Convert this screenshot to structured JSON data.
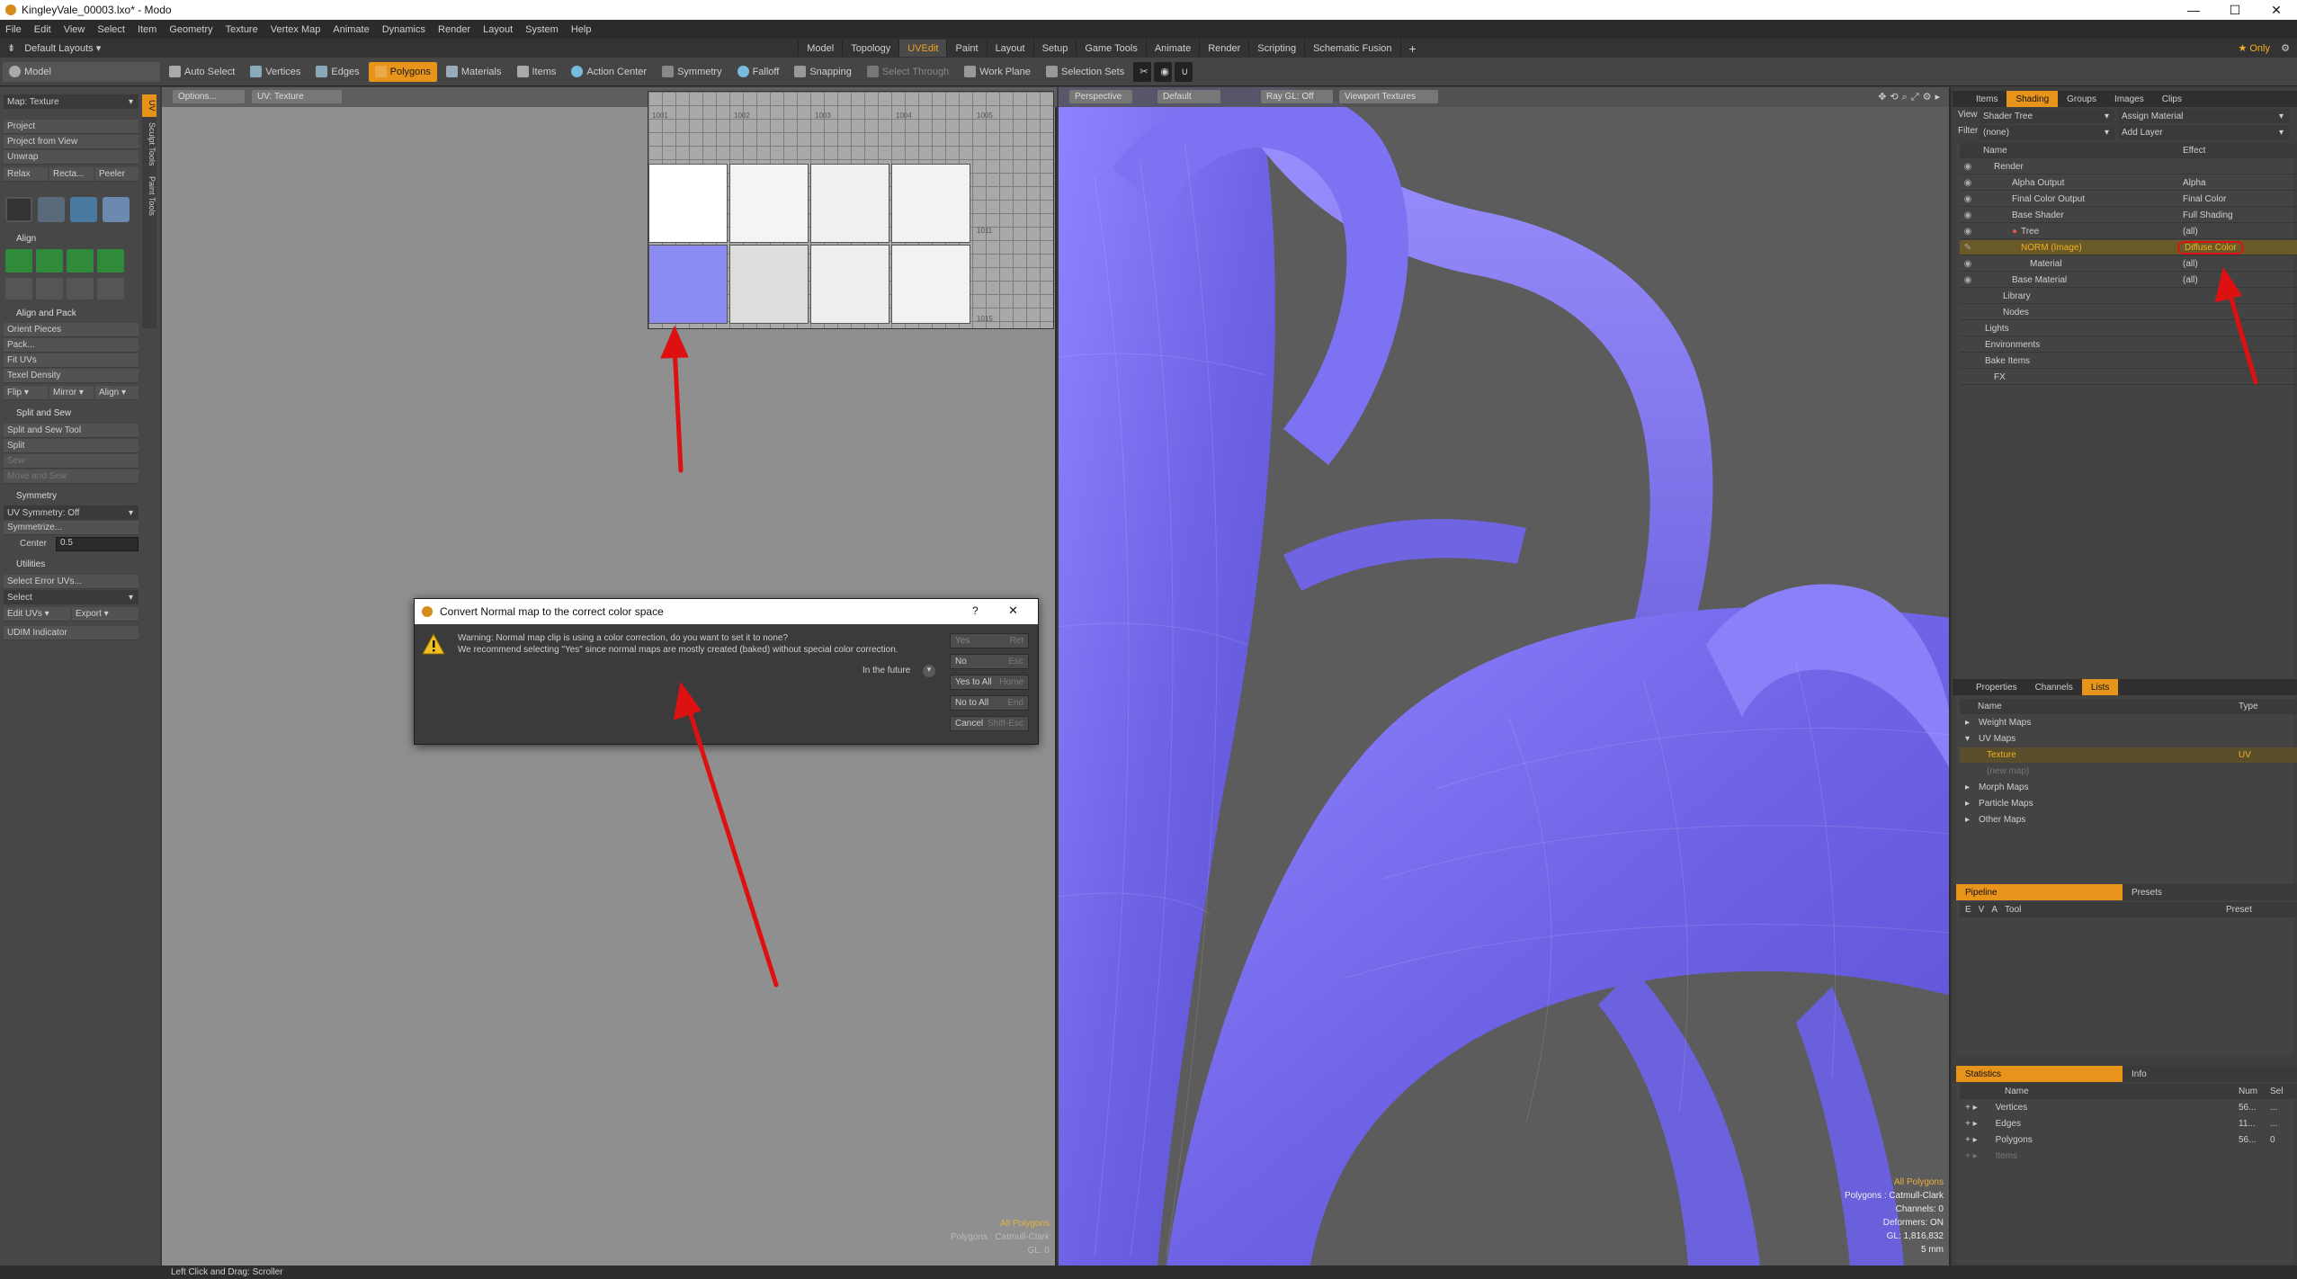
{
  "window": {
    "title": "KingleyVale_00003.lxo* - Modo",
    "controls": [
      "—",
      "☐",
      "✕"
    ]
  },
  "menu": [
    "File",
    "Edit",
    "View",
    "Select",
    "Item",
    "Geometry",
    "Texture",
    "Vertex Map",
    "Animate",
    "Dynamics",
    "Render",
    "Layout",
    "System",
    "Help"
  ],
  "layouts": {
    "default_label": "Default Layouts ▾",
    "tabs": [
      "Model",
      "Topology",
      "UVEdit",
      "Paint",
      "Layout",
      "Setup",
      "Game Tools",
      "Animate",
      "Render",
      "Scripting",
      "Schematic Fusion"
    ],
    "active": "UVEdit",
    "add": "+",
    "only": "★ Only"
  },
  "toolbar": {
    "mode": "Model",
    "items": [
      "Auto Select",
      "Vertices",
      "Edges",
      "Polygons",
      "Materials",
      "Items",
      "Action Center",
      "Symmetry",
      "Falloff",
      "Snapping",
      "Select Through",
      "Work Plane",
      "Selection Sets"
    ],
    "selected": "Polygons"
  },
  "left_panel": {
    "map": "Map: Texture",
    "project": [
      "Project",
      "Project from View",
      "Unwrap"
    ],
    "relax_row": [
      "Relax",
      "Recta...",
      "Peeler"
    ],
    "align_head": "Align",
    "align_pack_head": "Align and Pack",
    "align_pack": [
      "Orient Pieces",
      "Pack...",
      "Fit UVs",
      "Texel Density"
    ],
    "flip_row": [
      "Flip ▾",
      "Mirror ▾",
      "Align ▾"
    ],
    "split_head": "Split and Sew",
    "split": [
      "Split and Sew Tool",
      "Split",
      "Sew",
      "Move and Sew"
    ],
    "sym_head": "Symmetry",
    "uv_symmetry": "UV Symmetry: Off",
    "symmetrize": "Symmetrize...",
    "center_label": "Center",
    "center_value": "0.5",
    "util_head": "Utilities",
    "select_error": "Select Error UVs...",
    "select": "Select",
    "edit_uvs": "Edit UVs ▾",
    "export": "Export ▾",
    "udim": "UDIM Indicator",
    "side_tabs": [
      "UV",
      "Sculpt Tools",
      "Paint Tools"
    ]
  },
  "uv_view": {
    "options": "Options...",
    "uv_label": "UV: Texture",
    "udims": [
      "1001",
      "1002",
      "1003",
      "1004",
      "1005",
      "1011",
      "1015"
    ],
    "overlay": [
      "All Polygons",
      "Polygons : Catmull-Clark",
      "GL: 0"
    ]
  },
  "view3d": {
    "buttons": [
      "Perspective",
      "Default",
      "Ray GL: Off",
      "Viewport Textures"
    ],
    "overlay": [
      "All Polygons",
      "Polygons : Catmull-Clark",
      "Channels: 0",
      "Deformers: ON",
      "GL: 1,816,832",
      "5 mm"
    ]
  },
  "shading": {
    "tabs": [
      "Items",
      "Shading",
      "Groups",
      "Images",
      "Clips"
    ],
    "active": "Shading",
    "view_label": "View",
    "view_value": "Shader Tree",
    "assign": "Assign Material",
    "filter_label": "Filter",
    "filter_value": "(none)",
    "add_layer": "Add Layer",
    "col_name": "Name",
    "col_effect": "Effect",
    "rows": [
      {
        "name": "Render",
        "effect": ""
      },
      {
        "name": "Alpha Output",
        "effect": "Alpha"
      },
      {
        "name": "Final Color Output",
        "effect": "Final Color"
      },
      {
        "name": "Base Shader",
        "effect": "Full Shading"
      },
      {
        "name": "Tree",
        "effect": "(all)"
      },
      {
        "name": "NORM (Image)",
        "effect": "Diffuse Color"
      },
      {
        "name": "Material",
        "effect": "(all)"
      },
      {
        "name": "Base Material",
        "effect": "(all)"
      },
      {
        "name": "Library",
        "effect": ""
      },
      {
        "name": "Nodes",
        "effect": ""
      },
      {
        "name": "Lights",
        "effect": ""
      },
      {
        "name": "Environments",
        "effect": ""
      },
      {
        "name": "Bake Items",
        "effect": ""
      },
      {
        "name": "FX",
        "effect": ""
      }
    ]
  },
  "lists": {
    "tabs": [
      "Properties",
      "Channels",
      "Lists"
    ],
    "active": "Lists",
    "col_name": "Name",
    "col_type": "Type",
    "rows": [
      {
        "name": "Weight Maps",
        "type": ""
      },
      {
        "name": "UV Maps",
        "type": ""
      },
      {
        "name": "Texture",
        "type": "UV"
      },
      {
        "name": "(new map)",
        "type": ""
      },
      {
        "name": "Morph Maps",
        "type": ""
      },
      {
        "name": "Particle Maps",
        "type": ""
      },
      {
        "name": "Other Maps",
        "type": ""
      }
    ]
  },
  "pipeline": {
    "tabs": [
      "Pipeline",
      "Presets"
    ],
    "cols": [
      "E",
      "V",
      "A",
      "Tool",
      "Preset"
    ]
  },
  "statistics": {
    "tabs": [
      "Statistics",
      "Info"
    ],
    "cols": [
      "Name",
      "Num",
      "Sel"
    ],
    "rows": [
      {
        "name": "Vertices",
        "num": "56...",
        "sel": "..."
      },
      {
        "name": "Edges",
        "num": "11...",
        "sel": "..."
      },
      {
        "name": "Polygons",
        "num": "56...",
        "sel": "0"
      },
      {
        "name": "Items",
        "num": "",
        "sel": ""
      }
    ]
  },
  "dialog": {
    "title": "Convert Normal map to the correct color space",
    "help": "?",
    "close": "✕",
    "line1": "Warning: Normal map clip is using a color correction, do you want to set it to none?",
    "line2": "We recommend selecting \"Yes\" since normal maps are mostly created (baked) without special color correction.",
    "future": "In the future",
    "buttons": [
      {
        "label": "Yes",
        "key": "Ret"
      },
      {
        "label": "No",
        "key": "Esc"
      },
      {
        "label": "Yes to All",
        "key": "Home"
      },
      {
        "label": "No to All",
        "key": "End"
      },
      {
        "label": "Cancel",
        "key": "Shift-Esc"
      }
    ]
  },
  "status": {
    "text": "Left Click and Drag:  Scroller"
  },
  "colors": {
    "accent": "#e8941a",
    "annotation": "#dd1111",
    "mesh": "#7b6ff0"
  }
}
